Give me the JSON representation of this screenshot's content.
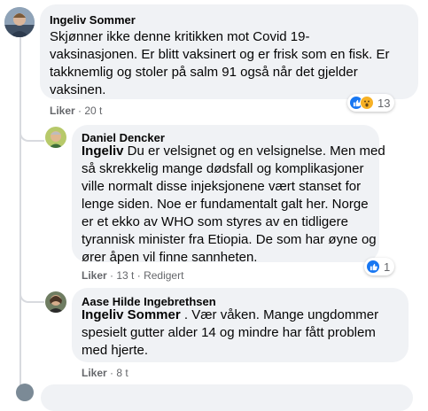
{
  "comments": [
    {
      "author": "Ingeliv Sommer",
      "text_lines": [
        "Skjønner ikke denne kritikken mot Covid 19-",
        "vaksinasjonen. Er blitt vaksinert og er frisk som en fisk. Er",
        "takknemlig og stoler på salm 91 også når det gjelder",
        "vaksinen."
      ],
      "like_label": "Liker",
      "separator": "·",
      "time": "20 t",
      "reaction_count": "13",
      "reaction_icons": [
        "like-icon",
        "wow-icon"
      ]
    },
    {
      "author": "Daniel Dencker",
      "mention": "Ingeliv",
      "text_first": " Du er velsignet og en velsignelse. Men med",
      "text_lines": [
        "så skrekkelig mange dødsfall og komplikasjoner",
        "ville normalt disse injeksjonene vært stanset for",
        "lenge siden. Noe er fundamentalt galt her. Norge",
        "er et ekko av WHO som styres av en tidligere",
        "tyrannisk minister fra Etiopia. De som har øyne og",
        "ører åpen vil finne sannheten."
      ],
      "like_label": "Liker",
      "separator": "·",
      "time": "13 t",
      "edited": "Redigert",
      "reaction_count": "1",
      "reaction_icons": [
        "like-icon"
      ]
    },
    {
      "author": "Aase Hilde Ingebrethsen",
      "mention": "Ingeliv Sommer",
      "text_first": " . Vær våken. Mange ungdommer",
      "text_lines": [
        "spesielt gutter alder 14 og mindre har fått problem",
        "med hjerte."
      ],
      "like_label": "Liker",
      "separator": "·",
      "time": "8 t"
    }
  ],
  "colors": {
    "bubble": "#f0f2f5",
    "like_blue": "#1877f2",
    "wow_yellow": "#f7b125",
    "secondary_text": "#65676b"
  }
}
